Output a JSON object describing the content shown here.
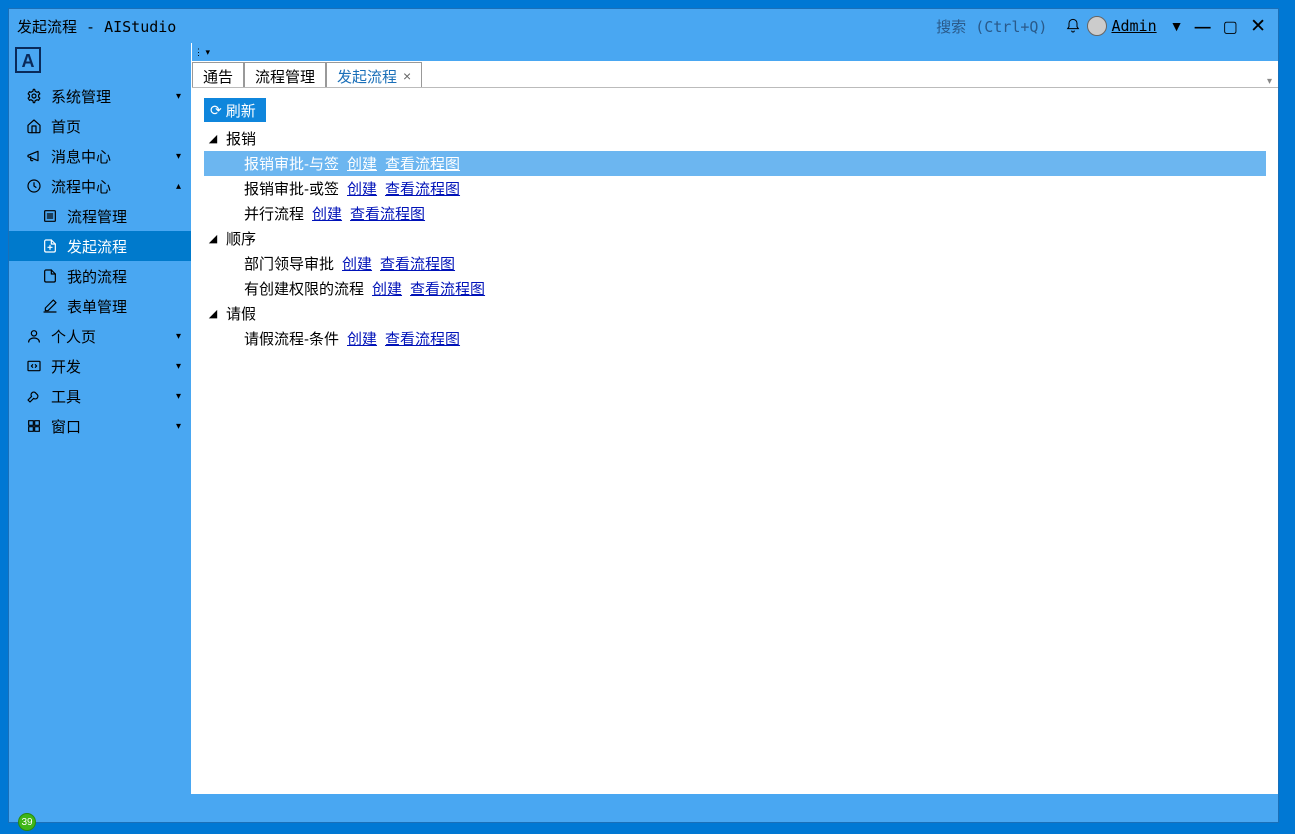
{
  "titlebar": {
    "title": "发起流程 - AIStudio",
    "search_hint": "搜索 (Ctrl+Q)",
    "admin_label": "Admin"
  },
  "sidebar": {
    "items": [
      {
        "label": "系统管理",
        "icon": "gear",
        "chevron": "▾"
      },
      {
        "label": "首页",
        "icon": "home",
        "chevron": ""
      },
      {
        "label": "消息中心",
        "icon": "megaphone",
        "chevron": "▾"
      },
      {
        "label": "流程中心",
        "icon": "clock",
        "chevron": "▴",
        "expanded": true,
        "children": [
          {
            "label": "流程管理",
            "icon": "list"
          },
          {
            "label": "发起流程",
            "icon": "file-plus",
            "selected": true
          },
          {
            "label": "我的流程",
            "icon": "file"
          },
          {
            "label": "表单管理",
            "icon": "edit"
          }
        ]
      },
      {
        "label": "个人页",
        "icon": "user",
        "chevron": "▾"
      },
      {
        "label": "开发",
        "icon": "code",
        "chevron": "▾"
      },
      {
        "label": "工具",
        "icon": "wrench",
        "chevron": "▾"
      },
      {
        "label": "窗口",
        "icon": "grid",
        "chevron": "▾"
      }
    ]
  },
  "tabs": [
    {
      "label": "通告",
      "active": false,
      "closable": false
    },
    {
      "label": "流程管理",
      "active": false,
      "closable": false
    },
    {
      "label": "发起流程",
      "active": true,
      "closable": true
    }
  ],
  "panel": {
    "refresh_label": "刷新",
    "create_label": "创建",
    "view_diagram_label": "查看流程图",
    "groups": [
      {
        "name": "报销",
        "items": [
          {
            "name": "报销审批-与签",
            "selected": true
          },
          {
            "name": "报销审批-或签"
          },
          {
            "name": "并行流程"
          }
        ]
      },
      {
        "name": "顺序",
        "items": [
          {
            "name": "部门领导审批"
          },
          {
            "name": "有创建权限的流程"
          }
        ]
      },
      {
        "name": "请假",
        "items": [
          {
            "name": "请假流程-条件"
          }
        ]
      }
    ]
  },
  "taskbar": {
    "badge": "39"
  }
}
